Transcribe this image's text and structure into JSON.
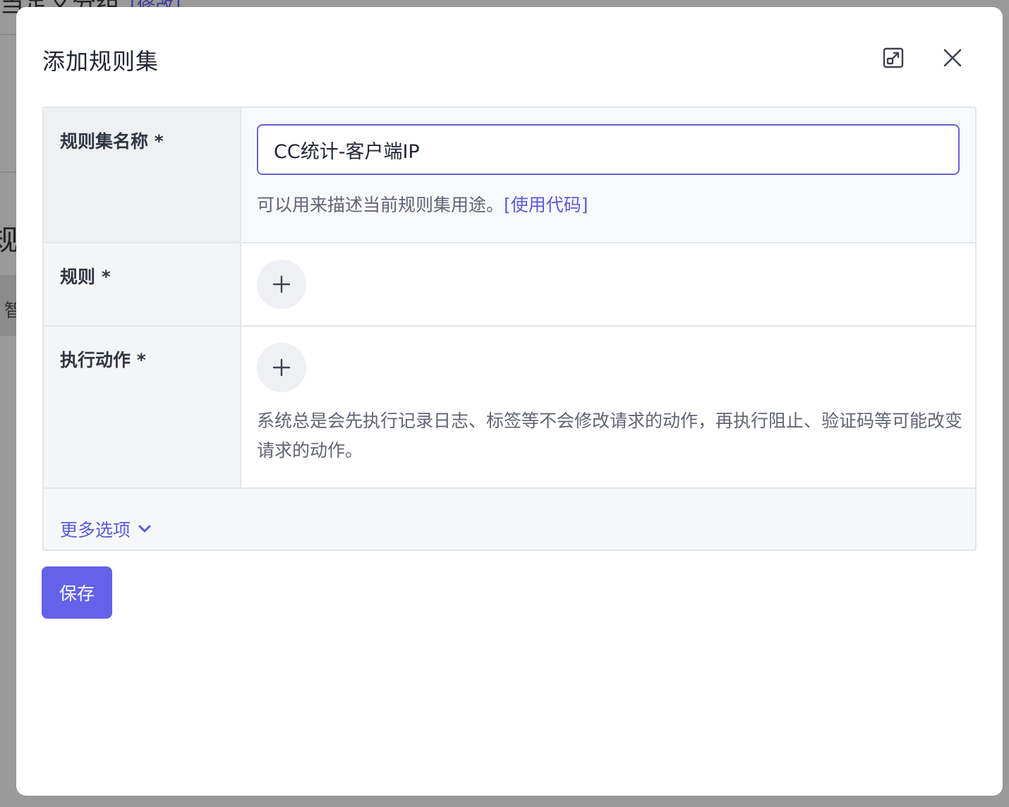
{
  "background": {
    "top_text": "当定义分组",
    "top_link": "[修改]",
    "left_glyph": "规",
    "left_tab": "智"
  },
  "modal": {
    "title": "添加规则集",
    "expand_icon": "expand-icon",
    "close_icon": "close-icon"
  },
  "form": {
    "name": {
      "label": "规则集名称 *",
      "value": "CC统计-客户端IP",
      "hint": "可以用来描述当前规则集用途。",
      "hint_link": "[使用代码]"
    },
    "rules": {
      "label": "规则 *",
      "add_icon": "plus-icon"
    },
    "actions": {
      "label": "执行动作 *",
      "add_icon": "plus-icon",
      "hint": "系统总是会先执行记录日志、标签等不会修改请求的动作，再执行阻止、验证码等可能改变请求的动作。"
    },
    "more_options": {
      "label": "更多选项",
      "icon": "chevron-down-icon"
    }
  },
  "save_label": "保存",
  "colors": {
    "accent": "#6362e8",
    "link": "#5b5bd6",
    "border": "#e3e6ec",
    "label_bg": "#f4f5f7"
  }
}
